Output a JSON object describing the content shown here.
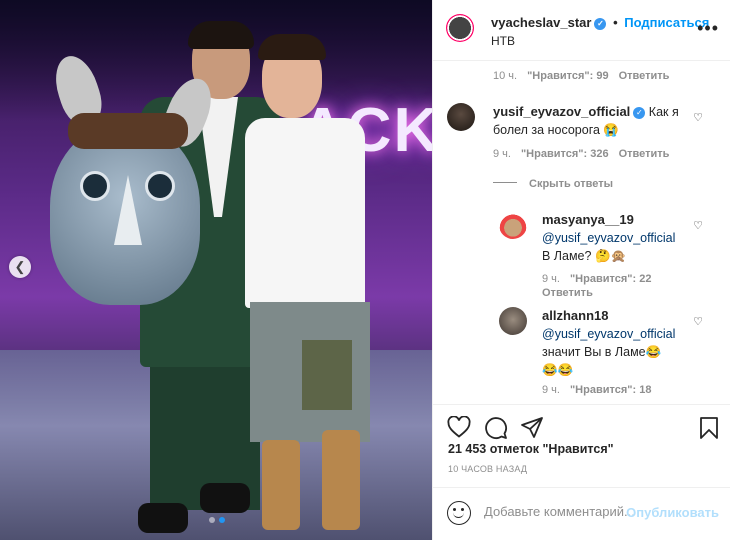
{
  "post": {
    "author": "vyacheslav_star",
    "dot": "•",
    "follow_label": "Подписаться",
    "location": "НТВ",
    "photo_sign": "ACKA"
  },
  "comments": {
    "top_meta": {
      "time": "10 ч.",
      "likes": "\"Нравится\": 99",
      "reply": "Ответить"
    },
    "c1": {
      "user": "yusif_eyvazov_official",
      "text": "Как я болел за носорога",
      "emoji": "😭",
      "time": "9 ч.",
      "likes": "\"Нравится\": 326",
      "reply": "Ответить"
    },
    "hide_replies": "Скрыть ответы",
    "r1": {
      "user": "masyanya__19",
      "mention": "@yusif_eyvazov_official",
      "text": "В Ламе?",
      "emoji": "🤔🙊",
      "time": "9 ч.",
      "likes": "\"Нравится\": 22",
      "reply": "Ответить"
    },
    "r2": {
      "user": "allzhann18",
      "mention": "@yusif_eyvazov_official",
      "text": "значит Вы в Ламе",
      "emoji": "😂",
      "emoji2": "😂😂",
      "time": "9 ч.",
      "likes": "\"Нравится\": 18"
    }
  },
  "stats": {
    "likes": "21 453 отметок \"Нравится\"",
    "time": "10 ЧАСОВ НАЗАД"
  },
  "add_comment": {
    "placeholder": "Добавьте комментарий...",
    "publish": "Опубликовать"
  },
  "icons": {
    "like": "heart-icon",
    "comment": "comment-icon",
    "share": "share-icon",
    "save": "bookmark-icon",
    "more": "more-icon",
    "verified": "verified-badge-icon",
    "emoji": "emoji-icon",
    "carousel_prev": "chevron-left-icon"
  },
  "colors": {
    "accent": "#0095f6",
    "verified": "#3897f0",
    "publish_disabled": "#b2dffc",
    "meta": "#8e8e8e"
  },
  "carousel": {
    "slides": 2,
    "current": 2
  }
}
